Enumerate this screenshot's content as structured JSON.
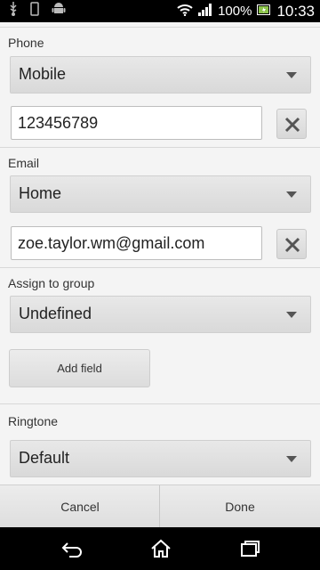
{
  "status_bar": {
    "battery_percent": "100%",
    "time": "10:33",
    "icons": [
      "usb-icon",
      "phone-icon",
      "android-icon",
      "wifi-icon",
      "signal-icon",
      "battery-icon"
    ]
  },
  "form": {
    "phone_label": "Phone",
    "phone_type": "Mobile",
    "phone_value": "123456789",
    "email_label": "Email",
    "email_type": "Home",
    "email_value": "zoe.taylor.wm@gmail.com",
    "group_label": "Assign to group",
    "group_value": "Undefined",
    "add_field_label": "Add field",
    "ringtone_label": "Ringtone",
    "ringtone_value": "Default"
  },
  "actions": {
    "cancel_label": "Cancel",
    "done_label": "Done"
  },
  "nav": {
    "icons": [
      "back-icon",
      "home-icon",
      "recent-apps-icon"
    ]
  }
}
